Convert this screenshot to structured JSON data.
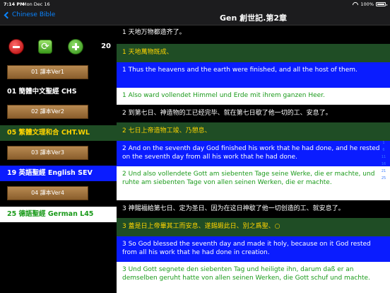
{
  "status": {
    "time": "7:14 PM",
    "date": "Mon Dec 16",
    "battery": "100%",
    "battery_level": 1.0
  },
  "nav": {
    "back_label": "Chinese Bible",
    "title": "Gen 創世記.第2章"
  },
  "controls": {
    "count": "20"
  },
  "versions": [
    {
      "button": "01 譯本Ver1",
      "name": "01 簡體中文聖經 CHS"
    },
    {
      "button": "02 譯本Ver2",
      "name": "05 繁體文理和合 CHT.WL"
    },
    {
      "button": "03 譯本Ver3",
      "name": "19 英語聖經 English SEV"
    },
    {
      "button": "04 譯本Ver4",
      "name": "25 德語聖經 German L45"
    }
  ],
  "verses": [
    {
      "text": "1 天地万物都造齐了。"
    },
    {
      "text": "1 天地萬物既成、"
    },
    {
      "text": "1 Thus the heavens and the earth were finished, and all the host of them."
    },
    {
      "text": "1 Also ward vollendet Himmel und Erde mit ihrem ganzen Heer."
    },
    {
      "text": "2 到第七日、神造物的工已经完毕、就在第七日歇了他一切的工、安息了。"
    },
    {
      "text": "2 七日上帝造物工竣、乃憩息、"
    },
    {
      "text": "2 And on the seventh day God finished his work that he had done, and he rested on the seventh day from all his work that he had done."
    },
    {
      "text": "2 Und also vollendete Gott am siebenten Tage seine Werke, die er machte, und ruhte am siebenten Tage von allen seinen Werken, die er machte."
    },
    {
      "text": "3 神賜福給第七日、定为圣日、因为在这日神歇了他一切创造的工、就安息了。"
    },
    {
      "text": "3 蓋是日上帝畢其工而安息、遂錫嘏此日、別之爲聖、○"
    },
    {
      "text": "3 So God blessed the seventh day and made it holy, because on it God rested from all his work that he had done in creation."
    },
    {
      "text": "3 Und Gott segnete den siebenten Tag und heiligte ihn, darum daß er an demselben geruht hatte von allen seinen Werken, die Gott schuf und machte."
    }
  ],
  "scroll_index": [
    "1",
    "6",
    "11",
    "16",
    "21",
    "25"
  ]
}
